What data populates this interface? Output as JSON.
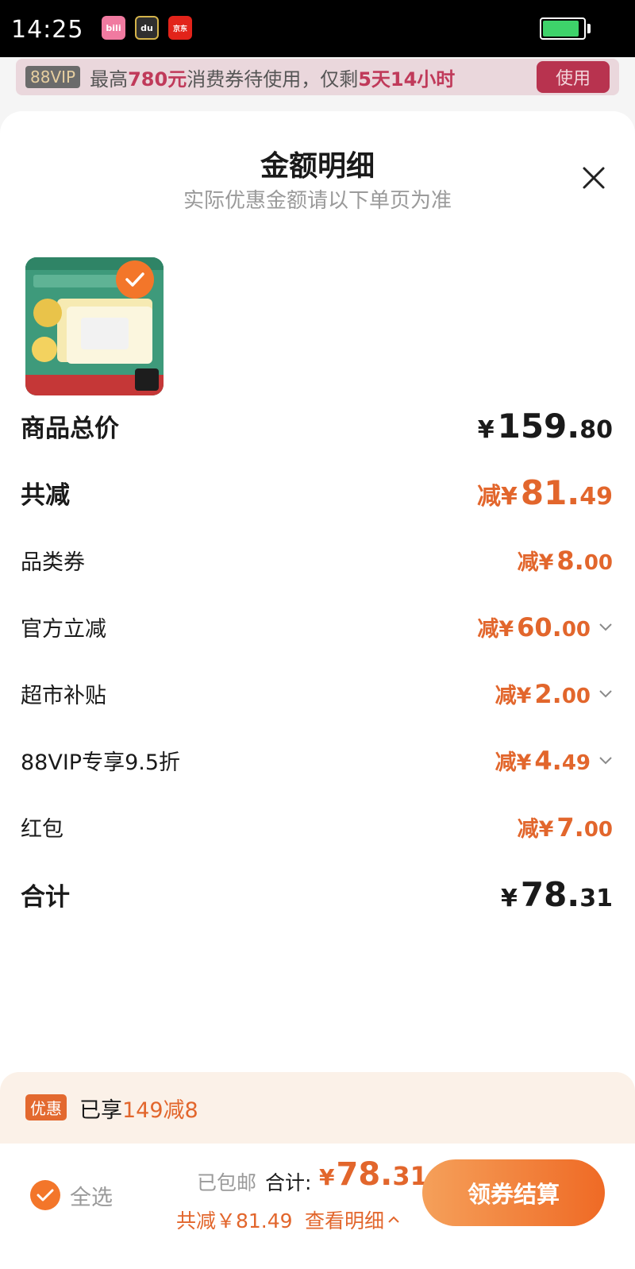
{
  "status_bar": {
    "time": "14:25",
    "apps": [
      {
        "icon": "bilibili-icon",
        "label": "bili",
        "color": "#f07aa0"
      },
      {
        "icon": "dewu-icon",
        "label": "du",
        "color": "#2f2f2f"
      },
      {
        "icon": "jd-icon",
        "label": "京东",
        "color": "#e2231a"
      }
    ],
    "battery_level": 0.9
  },
  "banner": {
    "badge": "88VIP",
    "text_prefix": "最高",
    "amount": "780元",
    "text_middle": "消费券待使用，仅剩",
    "remaining": "5天14小时",
    "button": "使用"
  },
  "sheet": {
    "title": "金额明细",
    "subtitle": "实际优惠金额请以下单页为准",
    "close_icon": "close-icon"
  },
  "product": {
    "image_icon": "product-thumbnail",
    "selected": true
  },
  "rows": [
    {
      "label": "商品总价",
      "prefix": "¥",
      "int": "159.",
      "dec": "80",
      "style": "bold",
      "color": "dark",
      "expandable": false
    },
    {
      "label": "共减",
      "prefix": "减¥",
      "int": "81.",
      "dec": "49",
      "style": "bold",
      "color": "orange",
      "expandable": false
    },
    {
      "label": "品类券",
      "prefix": "减¥",
      "int": "8.",
      "dec": "00",
      "style": "normal",
      "color": "orange",
      "expandable": false
    },
    {
      "label": "官方立减",
      "prefix": "减¥",
      "int": "60.",
      "dec": "00",
      "style": "normal",
      "color": "orange",
      "expandable": true
    },
    {
      "label": "超市补贴",
      "prefix": "减¥",
      "int": "2.",
      "dec": "00",
      "style": "normal",
      "color": "orange",
      "expandable": true
    },
    {
      "label": "88VIP专享9.5折",
      "prefix": "减¥",
      "int": "4.",
      "dec": "49",
      "style": "normal",
      "color": "orange",
      "expandable": true
    },
    {
      "label": "红包",
      "prefix": "减¥",
      "int": "7.",
      "dec": "00",
      "style": "normal",
      "color": "orange",
      "expandable": false
    },
    {
      "label": "合计",
      "prefix": "¥",
      "int": "78.",
      "dec": "31",
      "style": "bold",
      "color": "dark",
      "expandable": false
    }
  ],
  "promo": {
    "tag": "优惠",
    "text_prefix": "已享",
    "text_highlight": "149减8"
  },
  "bottom_bar": {
    "select_all": "全选",
    "free_shipping": "已包邮",
    "total_label": "合计:",
    "total_prefix": "¥",
    "total_int": "78.",
    "total_dec": "31",
    "saved": "共减￥81.49",
    "detail_link": "查看明细",
    "checkout": "领券结算"
  },
  "colors": {
    "accent": "#e2662c",
    "checkout_gradient_start": "#f5a05a",
    "checkout_gradient_end": "#ef6a25",
    "vip_red": "#b8334f"
  }
}
